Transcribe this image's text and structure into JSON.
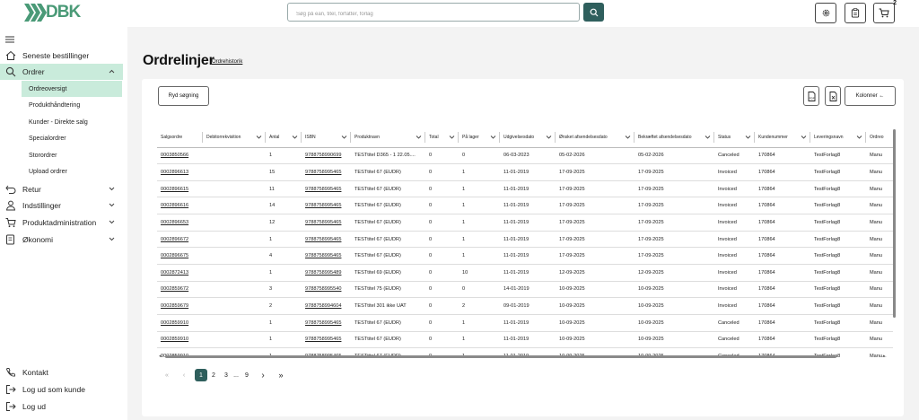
{
  "header": {
    "logo_text": "DBK",
    "search_placeholder": "Søg på ean, titel, forfatter, forlag",
    "cart_count": "2",
    "icons": [
      "gear-icon",
      "clipboard-icon",
      "cart-icon"
    ]
  },
  "colors": {
    "accent": "#2f5f5d",
    "active_nav": "#c9ebdb",
    "brand": "#4a9a77"
  },
  "sidebar": {
    "items": [
      {
        "label": "Seneste bestillinger",
        "icon": "home-icon"
      },
      {
        "label": "Ordrer",
        "icon": "search-icon",
        "expanded": true
      },
      {
        "label": "Retur",
        "icon": "return-icon"
      },
      {
        "label": "Indstillinger",
        "icon": "user-icon"
      },
      {
        "label": "Produktadministration",
        "icon": "cart-icon"
      },
      {
        "label": "Økonomi",
        "icon": "wallet-icon"
      }
    ],
    "subitems": [
      "Ordreoversigt",
      "Produkthåndtering",
      "Kunder - Direkte salg",
      "Specialordrer",
      "Storordrer",
      "Upload ordrer"
    ],
    "bottom": [
      {
        "label": "Kontakt",
        "icon": "phone-icon"
      },
      {
        "label": "Log ud som kunde",
        "icon": "logout-icon"
      },
      {
        "label": "Log ud",
        "icon": "logout-icon"
      }
    ]
  },
  "main": {
    "title": "Ordrelinjer",
    "history_link": "Ordrehistorik",
    "reset_label": "Ryd søgning",
    "columns_label": "Kolonner ←"
  },
  "table": {
    "headers": [
      "Salgsordre",
      "Debitorrekvisition",
      "Antal",
      "ISBN",
      "Produktnavn",
      "Total",
      "På lager",
      "Udgivelsesdato",
      "Ønsket afsendelsesdato",
      "Bekræftet afsendelsesdato",
      "Status",
      "Kundenummer",
      "Leveringsnavn",
      "Ordreo"
    ],
    "rows": [
      [
        "0003850566",
        "",
        "1",
        "9788758990699",
        "TESTtitel D365 - 1 22.05....",
        "0",
        "0",
        "06-03-2023",
        "05-02-2026",
        "05-02-2026",
        "Canceled",
        "170864",
        "TestForlag8",
        "Manu"
      ],
      [
        "0002896613",
        "",
        "15",
        "9788758995465",
        "TESTtitel 67 (EUDR)",
        "0",
        "1",
        "11-01-2019",
        "17-09-2025",
        "17-09-2025",
        "Invoiced",
        "170864",
        "TestForlag8",
        "Manu"
      ],
      [
        "0002896615",
        "",
        "11",
        "9788758995465",
        "TESTtitel 67 (EUDR)",
        "0",
        "1",
        "11-01-2019",
        "17-09-2025",
        "17-09-2025",
        "Invoiced",
        "170864",
        "TestForlag8",
        "Manu"
      ],
      [
        "0002896616",
        "",
        "14",
        "9788758995465",
        "TESTtitel 67 (EUDR)",
        "0",
        "1",
        "11-01-2019",
        "17-09-2025",
        "17-09-2025",
        "Invoiced",
        "170864",
        "TestForlag8",
        "Manu"
      ],
      [
        "0002896653",
        "",
        "12",
        "9788758995465",
        "TESTtitel 67 (EUDR)",
        "0",
        "1",
        "11-01-2019",
        "17-09-2025",
        "17-09-2025",
        "Invoiced",
        "170864",
        "TestForlag8",
        "Manu"
      ],
      [
        "0002896672",
        "",
        "1",
        "9788758995465",
        "TESTtitel 67 (EUDR)",
        "0",
        "1",
        "11-01-2019",
        "17-09-2025",
        "17-09-2025",
        "Invoiced",
        "170864",
        "TestForlag8",
        "Manu"
      ],
      [
        "0002896675",
        "",
        "4",
        "9788758995465",
        "TESTtitel 67 (EUDR)",
        "0",
        "1",
        "11-01-2019",
        "17-09-2025",
        "17-09-2025",
        "Invoiced",
        "170864",
        "TestForlag8",
        "Manu"
      ],
      [
        "0002872413",
        "",
        "1",
        "9788758995489",
        "TESTtitel 69 (EUDR)",
        "0",
        "10",
        "11-01-2019",
        "12-09-2025",
        "12-09-2025",
        "Invoiced",
        "170864",
        "TestForlag8",
        "Manu"
      ],
      [
        "0002859672",
        "",
        "3",
        "9788758995540",
        "TESTtitel 75 (EUDR)",
        "0",
        "0",
        "14-01-2019",
        "10-09-2025",
        "10-09-2025",
        "Invoiced",
        "170864",
        "TestForlag8",
        "Manu"
      ],
      [
        "0002859679",
        "",
        "2",
        "9788758994604",
        "TESTtitel 301 ikke UAT",
        "0",
        "2",
        "09-01-2019",
        "10-09-2025",
        "10-09-2025",
        "Invoiced",
        "170864",
        "TestForlag8",
        "Manu"
      ],
      [
        "0002859910",
        "",
        "1",
        "9788758995465",
        "TESTtitel 67 (EUDR)",
        "0",
        "1",
        "11-01-2019",
        "10-09-2025",
        "10-09-2025",
        "Canceled",
        "170864",
        "TestForlag8",
        "Manu"
      ],
      [
        "0002859910",
        "",
        "1",
        "9788758995465",
        "TESTtitel 67 (EUDR)",
        "0",
        "1",
        "11-01-2019",
        "10-09-2025",
        "10-09-2025",
        "Canceled",
        "170864",
        "TestForlag8",
        "Manu"
      ],
      [
        "0002859910",
        "",
        "1",
        "9788758995465",
        "TESTtitel 67 (EUDR)",
        "0",
        "1",
        "11-01-2019",
        "10-09-2025",
        "10-09-2025",
        "Canceled",
        "170864",
        "TestForlag8",
        "Manu..."
      ]
    ]
  },
  "pagination": {
    "first": "«",
    "prev": "‹",
    "pages": [
      "1",
      "2",
      "3"
    ],
    "ellipsis": "...",
    "last_page": "9",
    "next": "›",
    "last": "»",
    "current": "1"
  }
}
